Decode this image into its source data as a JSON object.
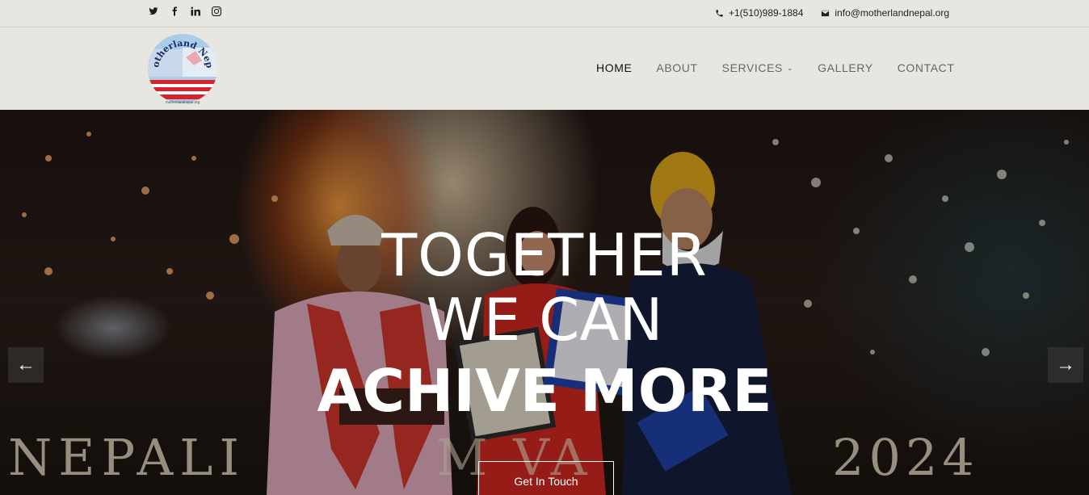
{
  "topbar": {
    "social": [
      {
        "name": "twitter-icon"
      },
      {
        "name": "facebook-icon"
      },
      {
        "name": "linkedin-icon"
      },
      {
        "name": "instagram-icon"
      }
    ],
    "phone": "+1(510)989-1884",
    "email": "info@motherlandnepal.org"
  },
  "logo": {
    "text": "Motherland Nepal",
    "subtext": "motherlandnepal.org"
  },
  "nav": {
    "items": [
      "HOME",
      "ABOUT",
      "SERVICES",
      "GALLERY",
      "CONTACT"
    ],
    "active": "HOME"
  },
  "hero": {
    "line1": "TOGETHER",
    "line2": "WE CAN",
    "line3": "ACHIVE MORE",
    "cta": "Get In Touch",
    "banner_text": "NEPALI",
    "banner_year": "2024",
    "banner_partial": "M  VA"
  },
  "colors": {
    "background": "#e8e6e1",
    "text_dark": "#111111",
    "nav_text": "#666666",
    "hero_text": "#ffffff"
  }
}
